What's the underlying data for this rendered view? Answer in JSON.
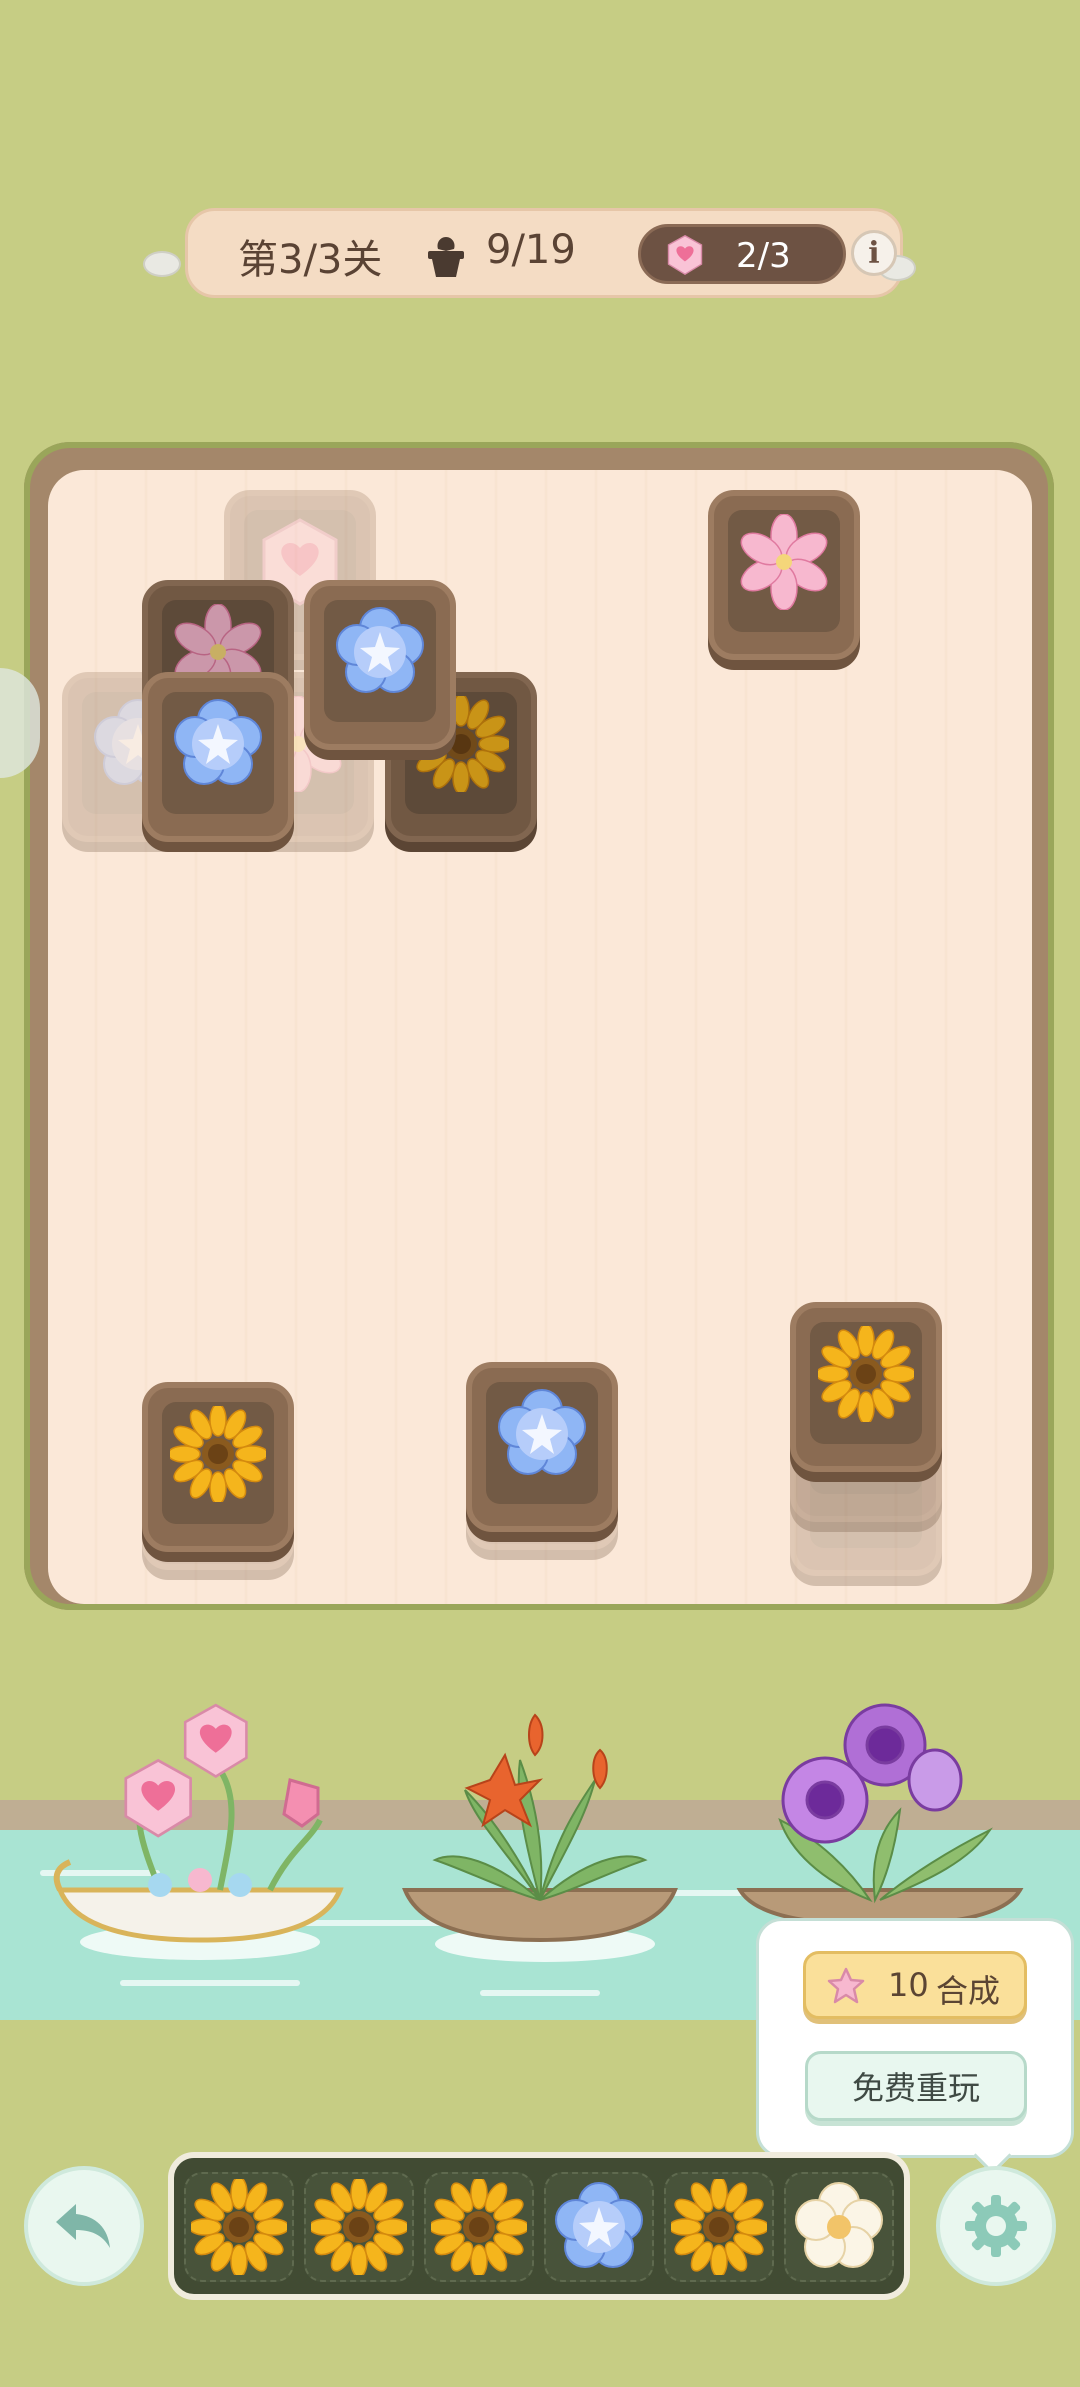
{
  "hud": {
    "level_text": "第3/3关",
    "pot_icon": "flower-pot-icon",
    "pot_count": "9/19",
    "gem_icon": "heart-gem-icon",
    "gem_count": "2/3",
    "info_label": "i"
  },
  "board": {
    "tiles": [
      {
        "flower": "gem",
        "state": "covered"
      },
      {
        "flower": "pink-lily",
        "state": "covered"
      },
      {
        "flower": "blue-morning-glory",
        "state": "covered"
      },
      {
        "flower": "blue-morning-glory",
        "state": "open"
      },
      {
        "flower": "blue-morning-glory",
        "state": "open"
      },
      {
        "flower": "sunflower",
        "state": "covered"
      },
      {
        "flower": "pink-lily",
        "state": "open"
      },
      {
        "flower": "sunflower",
        "state": "open"
      },
      {
        "flower": "blue-morning-glory",
        "state": "open"
      },
      {
        "flower": "sunflower",
        "state": "open"
      }
    ]
  },
  "popup": {
    "compose_cost": "10",
    "compose_label": "合成",
    "replay_label": "免费重玩"
  },
  "tray": {
    "slots": [
      "sunflower",
      "sunflower",
      "sunflower",
      "blue-morning-glory",
      "sunflower",
      "white-plum"
    ]
  },
  "buttons": {
    "undo_icon": "undo-arrow-icon",
    "settings_icon": "gear-icon"
  },
  "colors": {
    "background": "#c6cd84",
    "tile": "#8a6b52",
    "tray": "#414b33"
  }
}
